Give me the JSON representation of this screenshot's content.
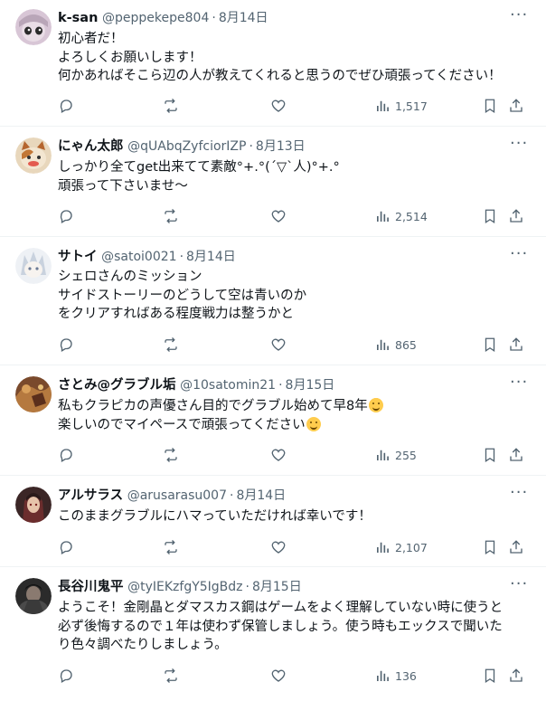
{
  "tweets": [
    {
      "name": "k-san",
      "handle": "@peppekepe804",
      "date": "8月14日",
      "lines": [
        "初心者だ！",
        "よろしくお願いします！",
        "何かあればそこら辺の人が教えてくれると思うのでぜひ頑張ってください！"
      ],
      "views": "1,517",
      "avatar_color": "#c9b8c8"
    },
    {
      "name": "にゃん太郎",
      "handle": "@qUAbqZyfciorIZP",
      "date": "8月13日",
      "lines": [
        "しっかり全てget出来てて素敵°+.°(´▽`人)°+.°",
        "頑張って下さいませ〜"
      ],
      "views": "2,514",
      "avatar_color": "#d9b27a"
    },
    {
      "name": "サトイ",
      "handle": "@satoi0021",
      "date": "8月14日",
      "lines": [
        "シェロさんのミッション",
        "サイドストーリーのどうして空は青いのか",
        "をクリアすればある程度戦力は整うかと"
      ],
      "views": "865",
      "avatar_color": "#dfe3ea"
    },
    {
      "name": "さとみ@グラブル垢",
      "handle": "@10satomin21",
      "date": "8月15日",
      "lines": [
        "私もクラピカの声優さん目的でグラブル始めて早8年",
        "楽しいのでマイペースで頑張ってください"
      ],
      "views": "255",
      "avatar_color": "#8a5a3a"
    },
    {
      "name": "アルサラス",
      "handle": "@arusarasu007",
      "date": "8月14日",
      "lines": [
        "このままグラブルにハマっていただければ幸いです！"
      ],
      "views": "2,107",
      "avatar_color": "#5b3a3a"
    },
    {
      "name": "長谷川鬼平",
      "handle": "@tyIEKzfgY5IgBdz",
      "date": "8月15日",
      "lines": [
        "ようこそ！金剛晶とダマスカス鋼はゲームをよく理解していない時に使うと",
        "必ず後悔するので１年は使わず保管しましょう。使う時もエックスで聞いた",
        "り色々調べたりしましょう。"
      ],
      "views": "136",
      "avatar_color": "#3a3a3a"
    }
  ],
  "icons": {
    "reply": "reply-icon",
    "retweet": "retweet-icon",
    "like": "like-icon",
    "views": "views-icon",
    "bookmark": "bookmark-icon",
    "share": "share-icon",
    "more": "more-icon"
  },
  "colors": {
    "text": "#0f1419",
    "muted": "#536471",
    "divider": "#eff3f4"
  }
}
